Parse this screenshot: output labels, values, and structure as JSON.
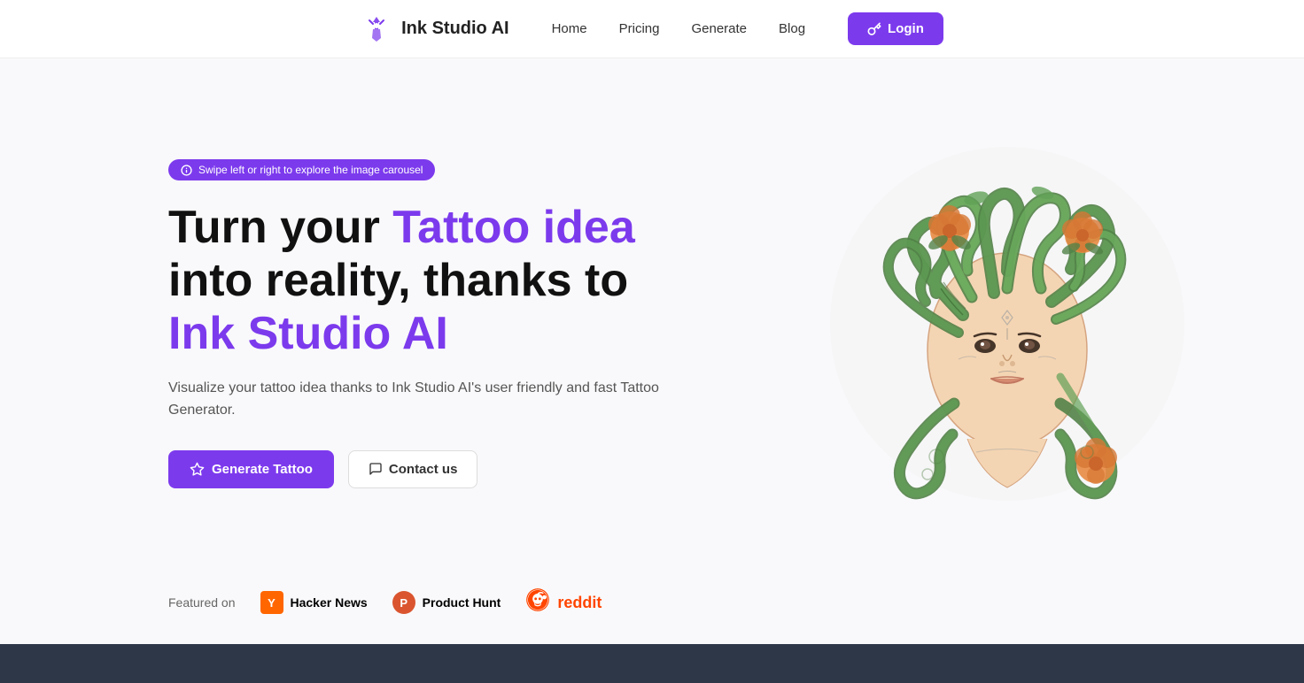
{
  "nav": {
    "brand": "Ink Studio AI",
    "links": [
      "Home",
      "Pricing",
      "Generate",
      "Blog"
    ],
    "login_label": "Login"
  },
  "hero": {
    "carousel_hint": "Swipe left or right to explore the image carousel",
    "title_part1": "Turn your ",
    "title_highlight1": "Tattoo idea",
    "title_part2": " into reality, thanks to ",
    "title_highlight2": "Ink Studio AI",
    "subtitle": "Visualize your tattoo idea thanks to Ink Studio AI's user friendly and fast Tattoo Generator.",
    "generate_btn": "Generate Tattoo",
    "contact_btn": "Contact us"
  },
  "featured": {
    "label": "Featured on",
    "items": [
      {
        "name": "Hacker News",
        "badge": "Y"
      },
      {
        "name": "Product Hunt",
        "badge": "P"
      },
      {
        "name": "reddit",
        "badge": "R"
      }
    ]
  }
}
